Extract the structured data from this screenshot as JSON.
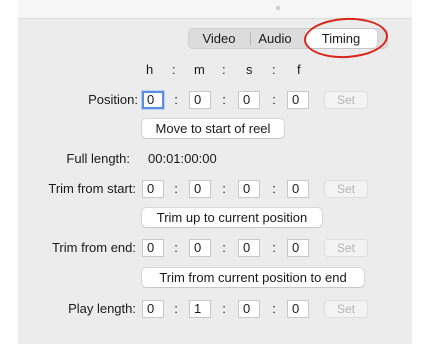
{
  "tabs": {
    "video": "Video",
    "audio": "Audio",
    "timing": "Timing"
  },
  "headers": {
    "h": "h",
    "sep1": ":",
    "m": "m",
    "sep2": ":",
    "s": "s",
    "sep3": ":",
    "f": "f"
  },
  "colon": ":",
  "position": {
    "label": "Position:",
    "h": "0",
    "m": "0",
    "s": "0",
    "f": "0",
    "set": "Set",
    "button": "Move to start of reel"
  },
  "full_length": {
    "label": "Full length:",
    "value": "00:01:00:00"
  },
  "trim_start": {
    "label": "Trim from start:",
    "h": "0",
    "m": "0",
    "s": "0",
    "f": "0",
    "set": "Set",
    "button": "Trim up to current position"
  },
  "trim_end": {
    "label": "Trim from end:",
    "h": "0",
    "m": "0",
    "s": "0",
    "f": "0",
    "set": "Set",
    "button": "Trim from current position to end"
  },
  "play_length": {
    "label": "Play length:",
    "h": "0",
    "m": "1",
    "s": "0",
    "f": "0",
    "set": "Set"
  },
  "colors": {
    "highlight_circle": "#d92418",
    "focus_ring": "#5a8fe0",
    "panel_bg": "#ececec"
  }
}
